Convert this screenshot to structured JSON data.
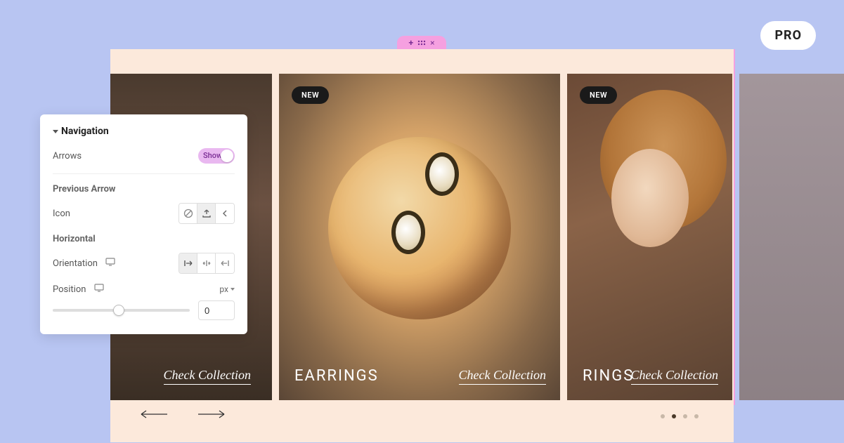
{
  "pro_label": "PRO",
  "edit_toolbar": {
    "plus": "+",
    "grip": "grip",
    "close": "×"
  },
  "cards": [
    {
      "badge": "",
      "title": "",
      "link": "Check Collection"
    },
    {
      "badge": "NEW",
      "title": "EARRINGS",
      "link": "Check Collection"
    },
    {
      "badge": "NEW",
      "title": "RINGS",
      "link": "Check Collection"
    },
    {
      "badge": "",
      "title": "",
      "link": ""
    }
  ],
  "dots": {
    "count": 4,
    "active": 1
  },
  "panel": {
    "title": "Navigation",
    "arrows_label": "Arrows",
    "toggle_text": "Show",
    "previous_arrow_heading": "Previous Arrow",
    "icon_label": "Icon",
    "horizontal_heading": "Horizontal",
    "orientation_label": "Orientation",
    "position_label": "Position",
    "unit": "px",
    "position_value": "0"
  }
}
